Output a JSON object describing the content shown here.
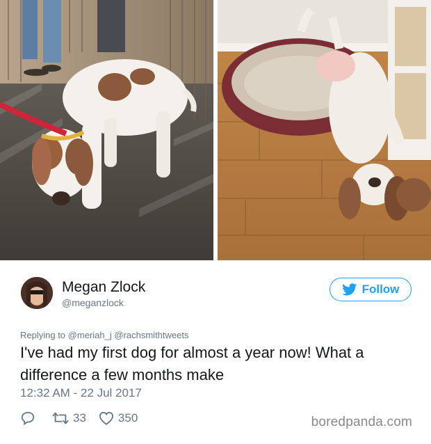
{
  "photos": {
    "left_alt": "",
    "right_alt": ""
  },
  "tweet": {
    "author": {
      "display_name": "Megan Zlock",
      "handle": "@meganzlock"
    },
    "follow_label": "Follow",
    "replying_prefix": "Replying to",
    "replying_to": [
      "@meriah_j",
      "@rachsmithtweets"
    ],
    "text": "I've had my first dog for almost a year now! What a difference a few months make",
    "timestamp": "12:32 AM - 22 Jul 2017",
    "actions": {
      "reply_count": "",
      "retweet_count": "33",
      "like_count": "350"
    }
  },
  "watermark": "boredpanda.com",
  "colors": {
    "accent": "#1da1f2",
    "text": "#14171a",
    "secondary": "#657786"
  },
  "icons": [
    "twitter-bird-icon",
    "reply-icon",
    "retweet-icon",
    "heart-icon"
  ]
}
